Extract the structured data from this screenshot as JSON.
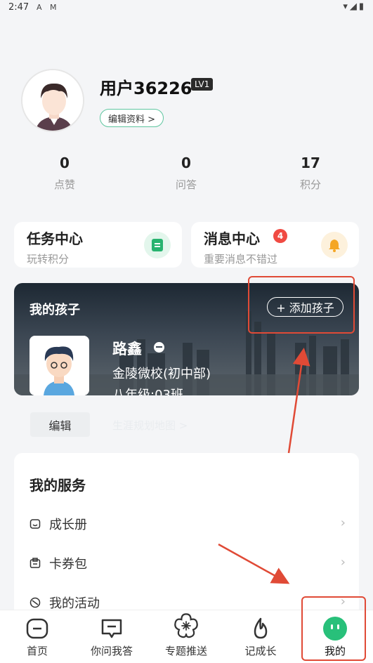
{
  "status_bar": {
    "time": "2:47",
    "left_icons": "A M",
    "right_icons": "▾◢▮"
  },
  "profile": {
    "username": "用户36226",
    "level": "LV1",
    "edit_label": "编辑资料 >"
  },
  "stats": [
    {
      "value": "0",
      "label": "点赞"
    },
    {
      "value": "0",
      "label": "问答"
    },
    {
      "value": "17",
      "label": "积分"
    }
  ],
  "task_center": {
    "title": "任务中心",
    "subtitle": "玩转积分",
    "icon": "task-list-icon",
    "color": "#28b36f"
  },
  "message_center": {
    "title": "消息中心",
    "badge": "4",
    "subtitle": "重要消息不错过",
    "icon": "bell-icon",
    "color": "#f5a623"
  },
  "children": {
    "title": "我的孩子",
    "add_label": "+ 添加孩子",
    "child": {
      "name": "路鑫",
      "school": "金陵微校(初中部)",
      "class": "八年级:03班"
    },
    "edit_label": "编辑",
    "faded_text": "生涯规划地图 >"
  },
  "services": {
    "title": "我的服务",
    "items": [
      {
        "label": "成长册",
        "icon": "growth-book-icon"
      },
      {
        "label": "卡券包",
        "icon": "coupon-icon"
      },
      {
        "label": "我的活动",
        "icon": "activity-icon"
      }
    ]
  },
  "bottom_nav": [
    {
      "label": "首页",
      "icon": "home-icon"
    },
    {
      "label": "你问我答",
      "icon": "qa-icon"
    },
    {
      "label": "专题推送",
      "icon": "flower-icon"
    },
    {
      "label": "记成长",
      "icon": "flame-icon"
    },
    {
      "label": "我的",
      "icon": "me-icon",
      "active": true
    }
  ],
  "colors": {
    "accent_green": "#28c07a",
    "annotation_red": "#e04a36",
    "badge_red": "#f04a42"
  }
}
